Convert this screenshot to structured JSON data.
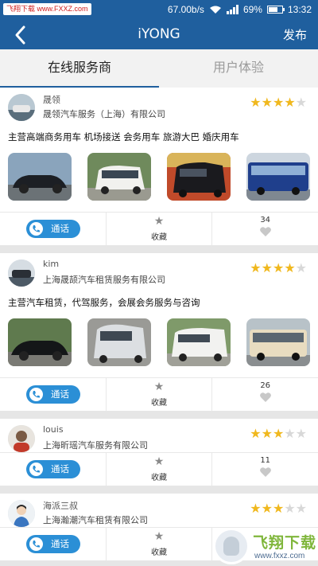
{
  "status_bar": {
    "watermark": "飞翔下载 www.FXXZ.com",
    "network_speed": "67.00b/s",
    "battery": "69%",
    "battery_level": 0.69,
    "time": "13:32"
  },
  "navbar": {
    "back_icon": "chevron-left-icon",
    "title": "iYONG",
    "publish": "发布"
  },
  "tabs": [
    {
      "label": "在线服务商",
      "active": true
    },
    {
      "label": "用户体验",
      "active": false
    }
  ],
  "providers": [
    {
      "name": "晟领",
      "company": "晟领汽车服务（上海）有限公司",
      "rating": 4,
      "description": "主营高端商务用车 机场接送 会务用车 旅游大巴 婚庆用车",
      "call_label": "通话",
      "favorite_label": "收藏",
      "likes": "34",
      "photos": [
        "black-sedan-photo",
        "white-mpv-photo",
        "black-van-photo",
        "blue-bus-photo"
      ]
    },
    {
      "name": "kim",
      "company": "上海晟颉汽车租赁服务有限公司",
      "rating": 4,
      "description": "主营汽车租赁，代驾服务，会展会务服务与咨询",
      "call_label": "通话",
      "favorite_label": "收藏",
      "likes": "26",
      "photos": [
        "black-sedan-photo",
        "silver-mpv-photo",
        "white-van-photo",
        "beige-bus-photo"
      ]
    },
    {
      "name": "louis",
      "company": "上海昕瑶汽车服务有限公司",
      "rating": 3,
      "description": "",
      "call_label": "通话",
      "favorite_label": "收藏",
      "likes": "11",
      "photos": []
    },
    {
      "name": "海派三叔",
      "company": "上海瀚潮汽车租赁有限公司",
      "rating": 3,
      "description": "",
      "call_label": "通话",
      "favorite_label": "收藏",
      "likes": "",
      "photos": []
    }
  ],
  "watermark_corner": {
    "name": "飞翔下载",
    "url": "www.fxxz.com"
  },
  "colors": {
    "brand_blue": "#1f5f9e",
    "call_button": "#2b8fd6",
    "star_on": "#f0b81e",
    "star_off": "#d8d8d8"
  }
}
